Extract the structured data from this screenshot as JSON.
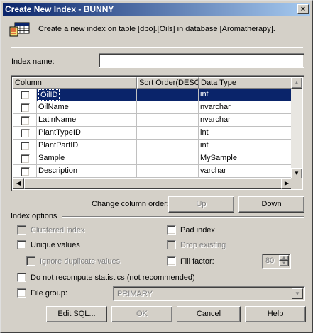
{
  "window": {
    "title": "Create New Index - BUNNY",
    "close_glyph": "×"
  },
  "header": {
    "icon": "table-index-icon",
    "description": "Create a new index on table [dbo].[Oils] in database [Aromatherapy]."
  },
  "index_name": {
    "label": "Index name:",
    "value": ""
  },
  "grid": {
    "columns": [
      "Column",
      "Sort Order(DESC)",
      "Data Type"
    ],
    "rows": [
      {
        "name": "OilID",
        "type": "int",
        "checked": false,
        "selected": true
      },
      {
        "name": "OilName",
        "type": "nvarchar",
        "checked": false
      },
      {
        "name": "LatinName",
        "type": "nvarchar",
        "checked": false
      },
      {
        "name": "PlantTypeID",
        "type": "int",
        "checked": false
      },
      {
        "name": "PlantPartID",
        "type": "int",
        "checked": false
      },
      {
        "name": "Sample",
        "type": "MySample",
        "checked": false
      },
      {
        "name": "Description",
        "type": "varchar",
        "checked": false
      }
    ]
  },
  "column_order": {
    "label": "Change column order:",
    "up": "Up",
    "down": "Down"
  },
  "options": {
    "group_label": "Index options",
    "clustered": "Clustered index",
    "unique": "Unique values",
    "ignore_dup": "Ignore duplicate values",
    "pad_index": "Pad index",
    "drop_existing": "Drop existing",
    "fill_factor": "Fill factor:",
    "fill_factor_value": "80",
    "no_recompute": "Do not recompute statistics (not recommended)",
    "file_group": "File group:",
    "file_group_value": "PRIMARY"
  },
  "buttons": {
    "edit_sql": "Edit SQL...",
    "ok": "OK",
    "cancel": "Cancel",
    "help": "Help"
  },
  "colors": {
    "title_start": "#0a246a",
    "title_end": "#a6caf0",
    "face": "#d4d0c8",
    "selection": "#0a246a"
  }
}
